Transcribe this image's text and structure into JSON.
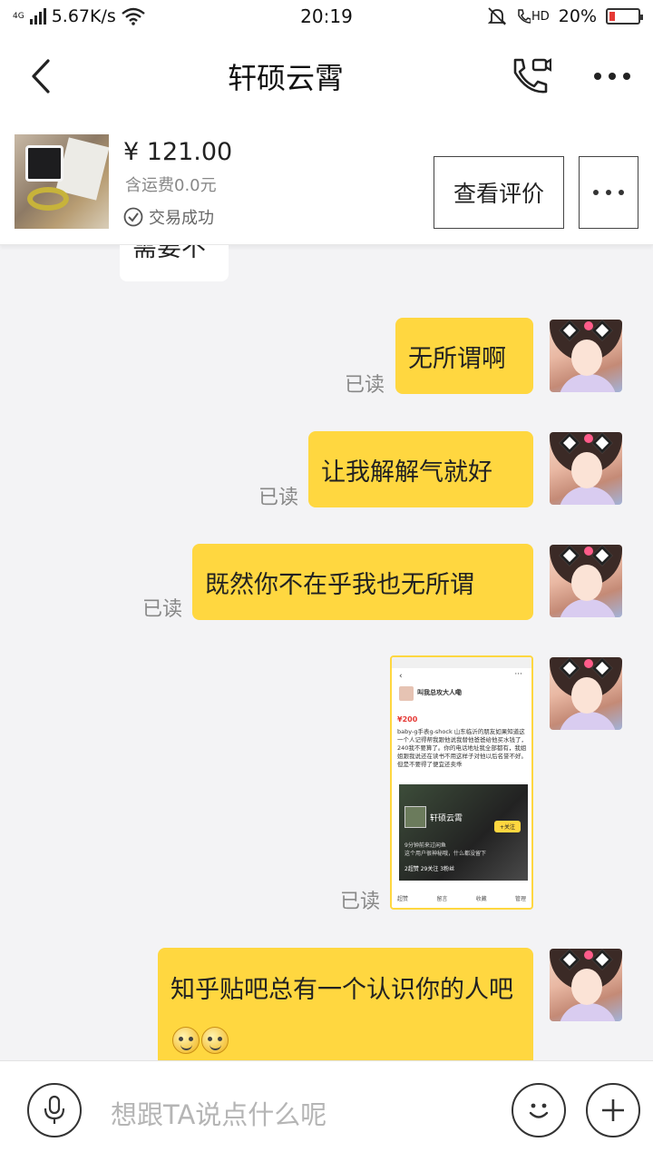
{
  "status_bar": {
    "network": "4G",
    "speed": "5.67K/s",
    "time": "20:19",
    "hd": "HD",
    "battery": "20%",
    "battery_level": 0.2,
    "battery_color": "#e53935"
  },
  "header": {
    "title": "轩硕云霄",
    "icons": [
      "back-arrow-icon",
      "video-call-icon",
      "more-icon"
    ]
  },
  "product": {
    "price": "¥ 121.00",
    "shipping": "含运费0.0元",
    "status": "交易成功",
    "review_button": "查看评价"
  },
  "chat": {
    "partial_message": "需要不",
    "messages": [
      {
        "text": "无所谓啊",
        "read": "已读"
      },
      {
        "text": "让我解解气就好",
        "read": "已读"
      },
      {
        "text": "既然你不在乎我也无所谓",
        "read": "已读"
      },
      {
        "type": "image",
        "read": "已读"
      },
      {
        "text": "知乎贴吧总有一个认识你的人吧",
        "read": ""
      }
    ],
    "screenshot_message": {
      "seller": "叫我总攻大人嘞",
      "price": "¥200",
      "description": "baby-g手表g-shock 山东临沂的朋友如果知道这一个人记得帮我跟他说我替他爸爸给他买水钱了，240我不要算了。你的电话地址我全部都有，我姐姐跟我说还在读书不用这样子对他以后名誉不好。但是不要得了便宜还卖乖",
      "profile_name": "轩硕云霄",
      "follow": "+关注",
      "line1": "9分钟前来过闲鱼",
      "line2": "这个用户很神秘哦，什么都没留下",
      "stats": "2超赞   29关注   3粉丝",
      "actions": [
        "超赞",
        "留言",
        "收藏",
        "管理"
      ]
    }
  },
  "input_bar": {
    "placeholder": "想跟TA说点什么呢"
  },
  "colors": {
    "accent": "#ffd740",
    "background": "#f3f3f5"
  }
}
